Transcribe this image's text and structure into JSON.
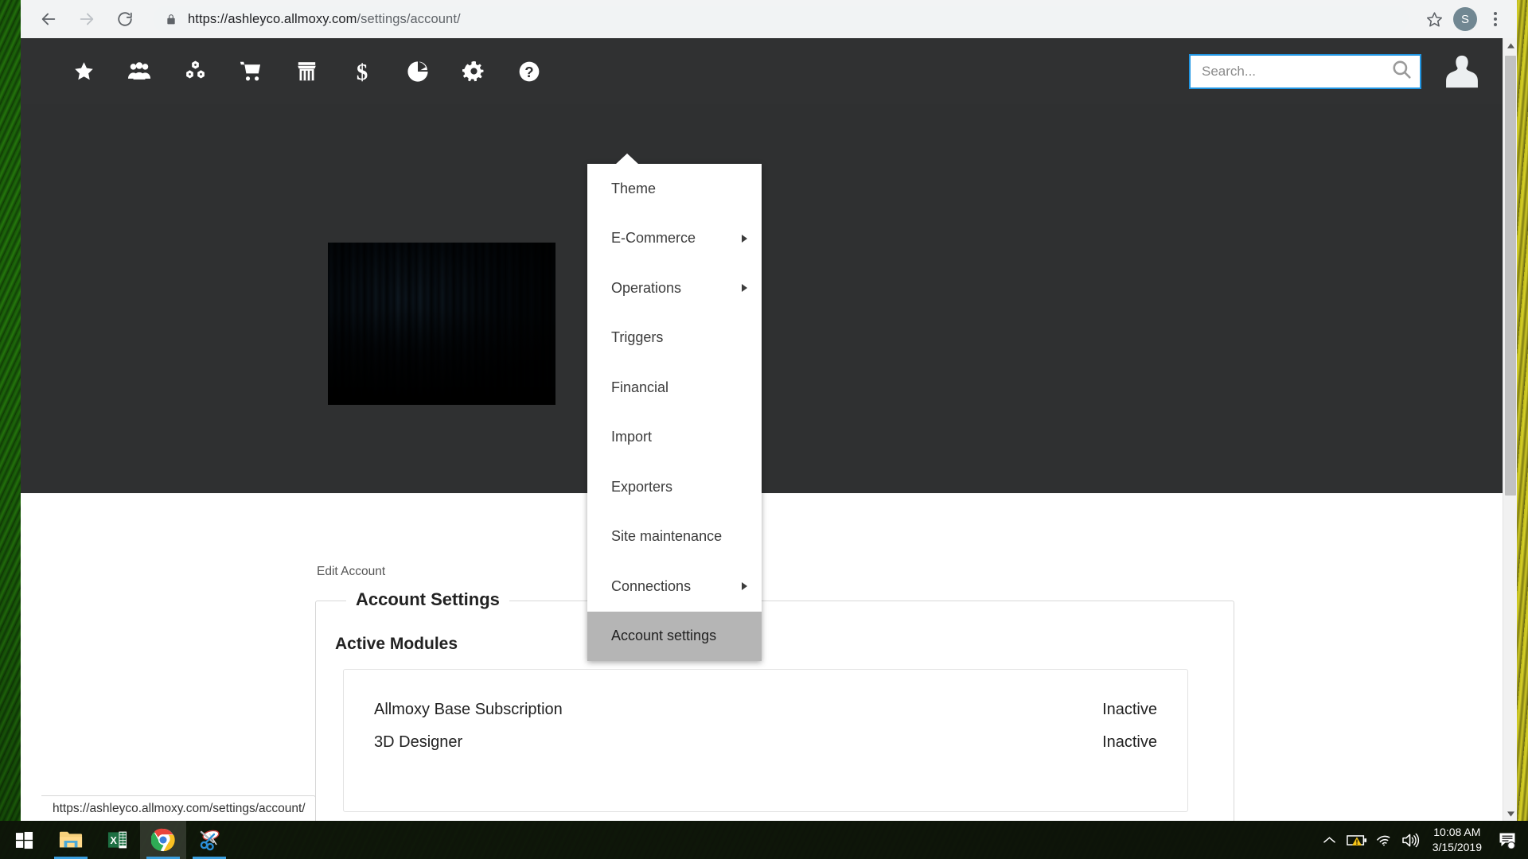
{
  "browser": {
    "back_icon": "arrow-left-icon",
    "forward_icon": "arrow-right-icon",
    "reload_icon": "reload-icon",
    "lock_icon": "lock-icon",
    "url_secure": "https://ashleyco.allmoxy.com",
    "url_path": "/settings/account/",
    "bookmark_icon": "star-outline-icon",
    "profile_initial": "S",
    "menu_icon": "three-dots-vertical-icon"
  },
  "app_nav": {
    "items": [
      {
        "icon": "star-icon",
        "name": "favorites",
        "active": false
      },
      {
        "icon": "users-icon",
        "name": "customers",
        "active": false
      },
      {
        "icon": "cubes-icon",
        "name": "products",
        "active": false
      },
      {
        "icon": "cart-icon",
        "name": "orders",
        "active": false
      },
      {
        "icon": "store-icon",
        "name": "shop",
        "active": false
      },
      {
        "icon": "dollar-icon",
        "name": "accounting",
        "active": false
      },
      {
        "icon": "pie-chart-icon",
        "name": "reports",
        "active": false
      },
      {
        "icon": "gear-icon",
        "name": "settings",
        "active": true
      },
      {
        "icon": "question-circle-icon",
        "name": "help",
        "active": false
      }
    ],
    "search_placeholder": "Search...",
    "search_value": "",
    "search_icon": "magnifier-icon",
    "avatar_icon": "user-avatar-icon",
    "accent_color": "#2196e3",
    "header_color": "#2f3031"
  },
  "dropdown": {
    "items": [
      {
        "label": "Theme",
        "has_submenu": false,
        "highlighted": false
      },
      {
        "label": "E-Commerce",
        "has_submenu": true,
        "highlighted": false
      },
      {
        "label": "Operations",
        "has_submenu": true,
        "highlighted": false
      },
      {
        "label": "Triggers",
        "has_submenu": false,
        "highlighted": false
      },
      {
        "label": "Financial",
        "has_submenu": false,
        "highlighted": false
      },
      {
        "label": "Import",
        "has_submenu": false,
        "highlighted": false
      },
      {
        "label": "Exporters",
        "has_submenu": false,
        "highlighted": false
      },
      {
        "label": "Site maintenance",
        "has_submenu": false,
        "highlighted": false
      },
      {
        "label": "Connections",
        "has_submenu": true,
        "highlighted": false
      },
      {
        "label": "Account settings",
        "has_submenu": false,
        "highlighted": true
      }
    ],
    "highlight_color": "#b5b5b5"
  },
  "page": {
    "breadcrumb": "Edit Account",
    "fieldset_legend": "Account Settings",
    "modules_heading": "Active Modules",
    "modules": [
      {
        "name": "Allmoxy Base Subscription",
        "status": "Inactive"
      },
      {
        "name": "3D Designer",
        "status": "Inactive"
      }
    ]
  },
  "status_bar": {
    "url": "https://ashleyco.allmoxy.com/settings/account/"
  },
  "taskbar": {
    "start_icon": "windows-logo-icon",
    "apps": [
      {
        "icon": "file-explorer-icon",
        "name": "file-explorer",
        "running": true,
        "active": false
      },
      {
        "icon": "excel-icon",
        "name": "excel",
        "running": false,
        "active": false
      },
      {
        "icon": "chrome-icon",
        "name": "chrome",
        "running": true,
        "active": true
      },
      {
        "icon": "snipping-tool-icon",
        "name": "snipping-tool",
        "running": true,
        "active": false
      }
    ],
    "tray": [
      {
        "icon": "chevron-up-icon",
        "name": "show-hidden-icons"
      },
      {
        "icon": "battery-warning-icon",
        "name": "battery"
      },
      {
        "icon": "wifi-icon",
        "name": "network"
      },
      {
        "icon": "volume-icon",
        "name": "volume"
      }
    ],
    "time": "10:08 AM",
    "date": "3/15/2019",
    "action_center_icon": "action-center-icon"
  }
}
